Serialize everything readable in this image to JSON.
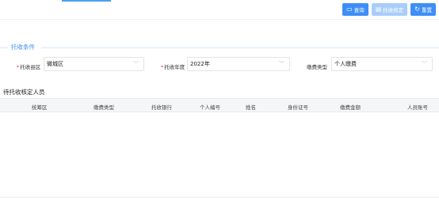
{
  "toolbar": {
    "query_label": "查询",
    "verify_label": "托收核定",
    "reset_label": "重置",
    "query_icon": "monitor-icon",
    "verify_icon": "document-icon",
    "reset_icon": "refresh-icon"
  },
  "conditions": {
    "section_title": "托收条件",
    "county_label": "托收县区",
    "county_value": "微城区",
    "year_label": "托收年度",
    "year_value": "2022年",
    "fee_type_label": "缴费类型",
    "fee_type_value": "个人缴费"
  },
  "table": {
    "title": "待托收核定人员",
    "columns": [
      "统筹区",
      "缴费类型",
      "托收银行",
      "个人编号",
      "姓名",
      "身份证号",
      "缴费金额",
      "人员账号"
    ]
  },
  "colors": {
    "accent": "#3e8ef7",
    "required": "#e6453a"
  }
}
